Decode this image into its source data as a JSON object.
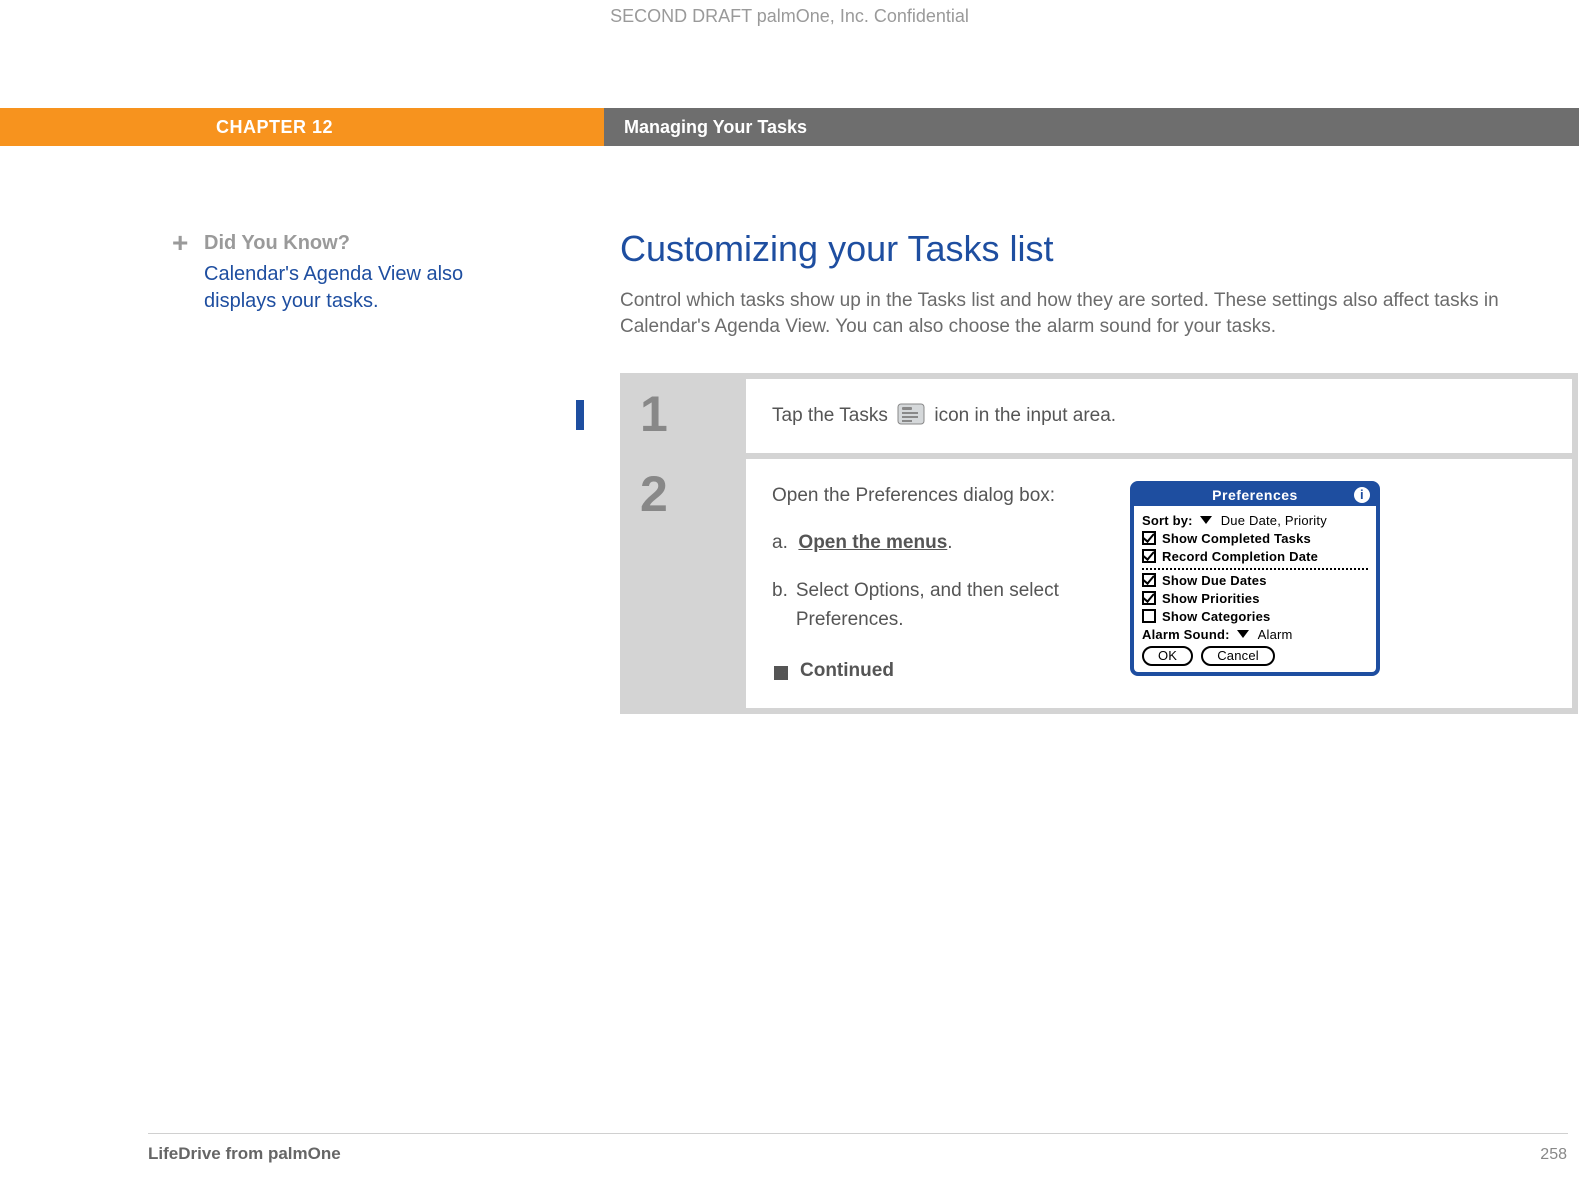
{
  "draft_header": "SECOND DRAFT palmOne, Inc.  Confidential",
  "chapter": {
    "label": "CHAPTER 12",
    "title": "Managing Your Tasks"
  },
  "sidebar": {
    "did_you_know_title": "Did You Know?",
    "did_you_know_body": "Calendar's Agenda View also displays your tasks."
  },
  "main": {
    "heading": "Customizing your Tasks list",
    "intro": "Control which tasks show up in the Tasks list and how they are sorted. These settings also affect tasks in Calendar's Agenda View. You can also choose the alarm sound for your tasks."
  },
  "steps": {
    "one": {
      "num": "1",
      "text_before": "Tap the Tasks",
      "text_after": "icon in the input area."
    },
    "two": {
      "num": "2",
      "intro": "Open the Preferences dialog box:",
      "a_prefix": "a.",
      "a_link": "Open the menus",
      "a_suffix": ".",
      "b_prefix": "b.",
      "b_text": "Select Options, and then select Preferences.",
      "continued": "Continued"
    }
  },
  "prefs": {
    "title": "Preferences",
    "sort_by_label": "Sort by:",
    "sort_by_value": "Due Date, Priority",
    "show_completed": "Show Completed Tasks",
    "record_completion": "Record Completion Date",
    "show_due_dates": "Show Due Dates",
    "show_priorities": "Show Priorities",
    "show_categories": "Show Categories",
    "alarm_sound_label": "Alarm Sound:",
    "alarm_sound_value": "Alarm",
    "ok": "OK",
    "cancel": "Cancel",
    "info": "i"
  },
  "footer": {
    "product": "LifeDrive from palmOne",
    "page_number": "258"
  }
}
